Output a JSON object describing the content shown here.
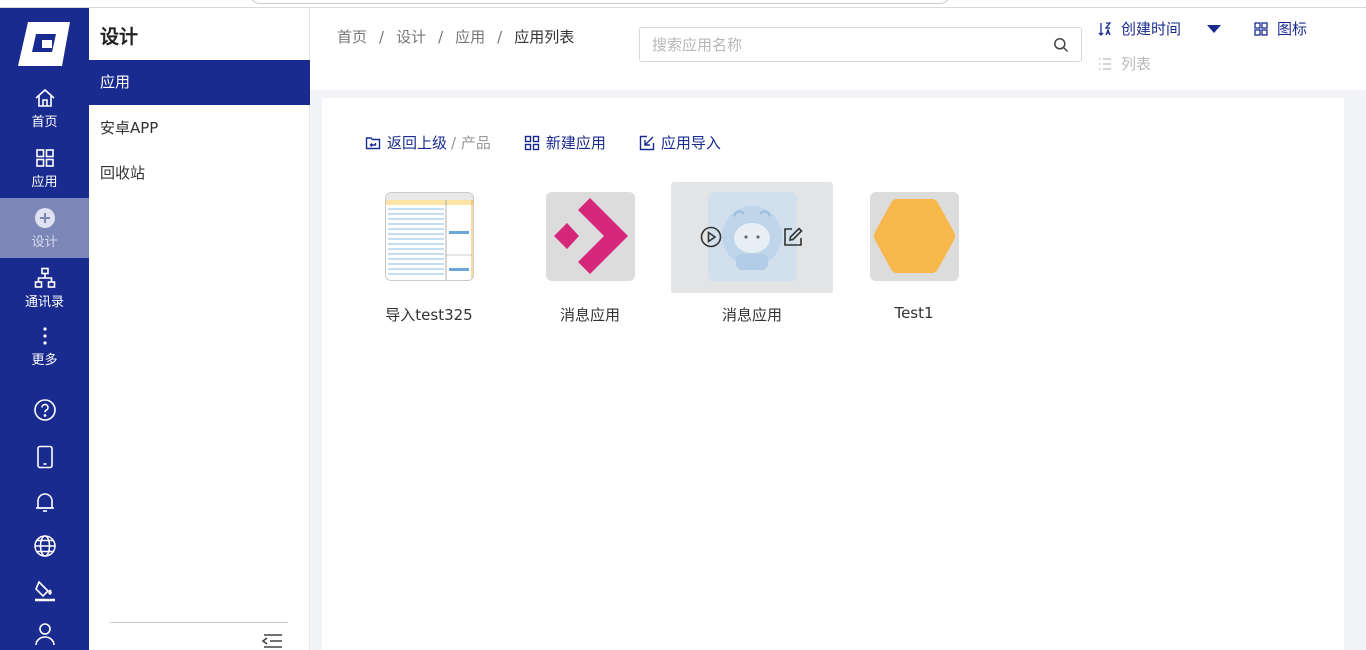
{
  "nav": {
    "items": [
      {
        "label": "首页",
        "icon": "home-icon"
      },
      {
        "label": "应用",
        "icon": "apps-grid-icon"
      },
      {
        "label": "设计",
        "icon": "plus-circle-icon"
      },
      {
        "label": "通讯录",
        "icon": "org-chart-icon"
      },
      {
        "label": "更多",
        "icon": "more-vertical-icon"
      }
    ],
    "bottom_icons": [
      "help-icon",
      "mobile-icon",
      "bell-icon",
      "globe-icon",
      "paint-bucket-icon",
      "user-icon"
    ]
  },
  "sidebar": {
    "title": "设计",
    "items": [
      {
        "label": "应用",
        "active": true
      },
      {
        "label": "安卓APP",
        "active": false
      },
      {
        "label": "回收站",
        "active": false
      }
    ]
  },
  "header": {
    "breadcrumb": [
      "首页",
      "设计",
      "应用",
      "应用列表"
    ],
    "separator": "/",
    "search_placeholder": "搜索应用名称",
    "sort_label": "创建时间",
    "view_grid_label": "图标",
    "view_list_label": "列表"
  },
  "toolbar": {
    "back_label": "返回上级",
    "back_sub": "/ 产品",
    "new_app_label": "新建应用",
    "import_label": "应用导入"
  },
  "apps": [
    {
      "name": "导入test325",
      "thumb": "table-image"
    },
    {
      "name": "消息应用",
      "thumb": "pink-diamond"
    },
    {
      "name": "消息应用",
      "thumb": "cartoon-image",
      "hover": true
    },
    {
      "name": "Test1",
      "thumb": "yellow-hexagon"
    }
  ],
  "colors": {
    "brand": "#1a2b8f",
    "pink": "#d6267b",
    "yellow": "#f8b84c"
  }
}
